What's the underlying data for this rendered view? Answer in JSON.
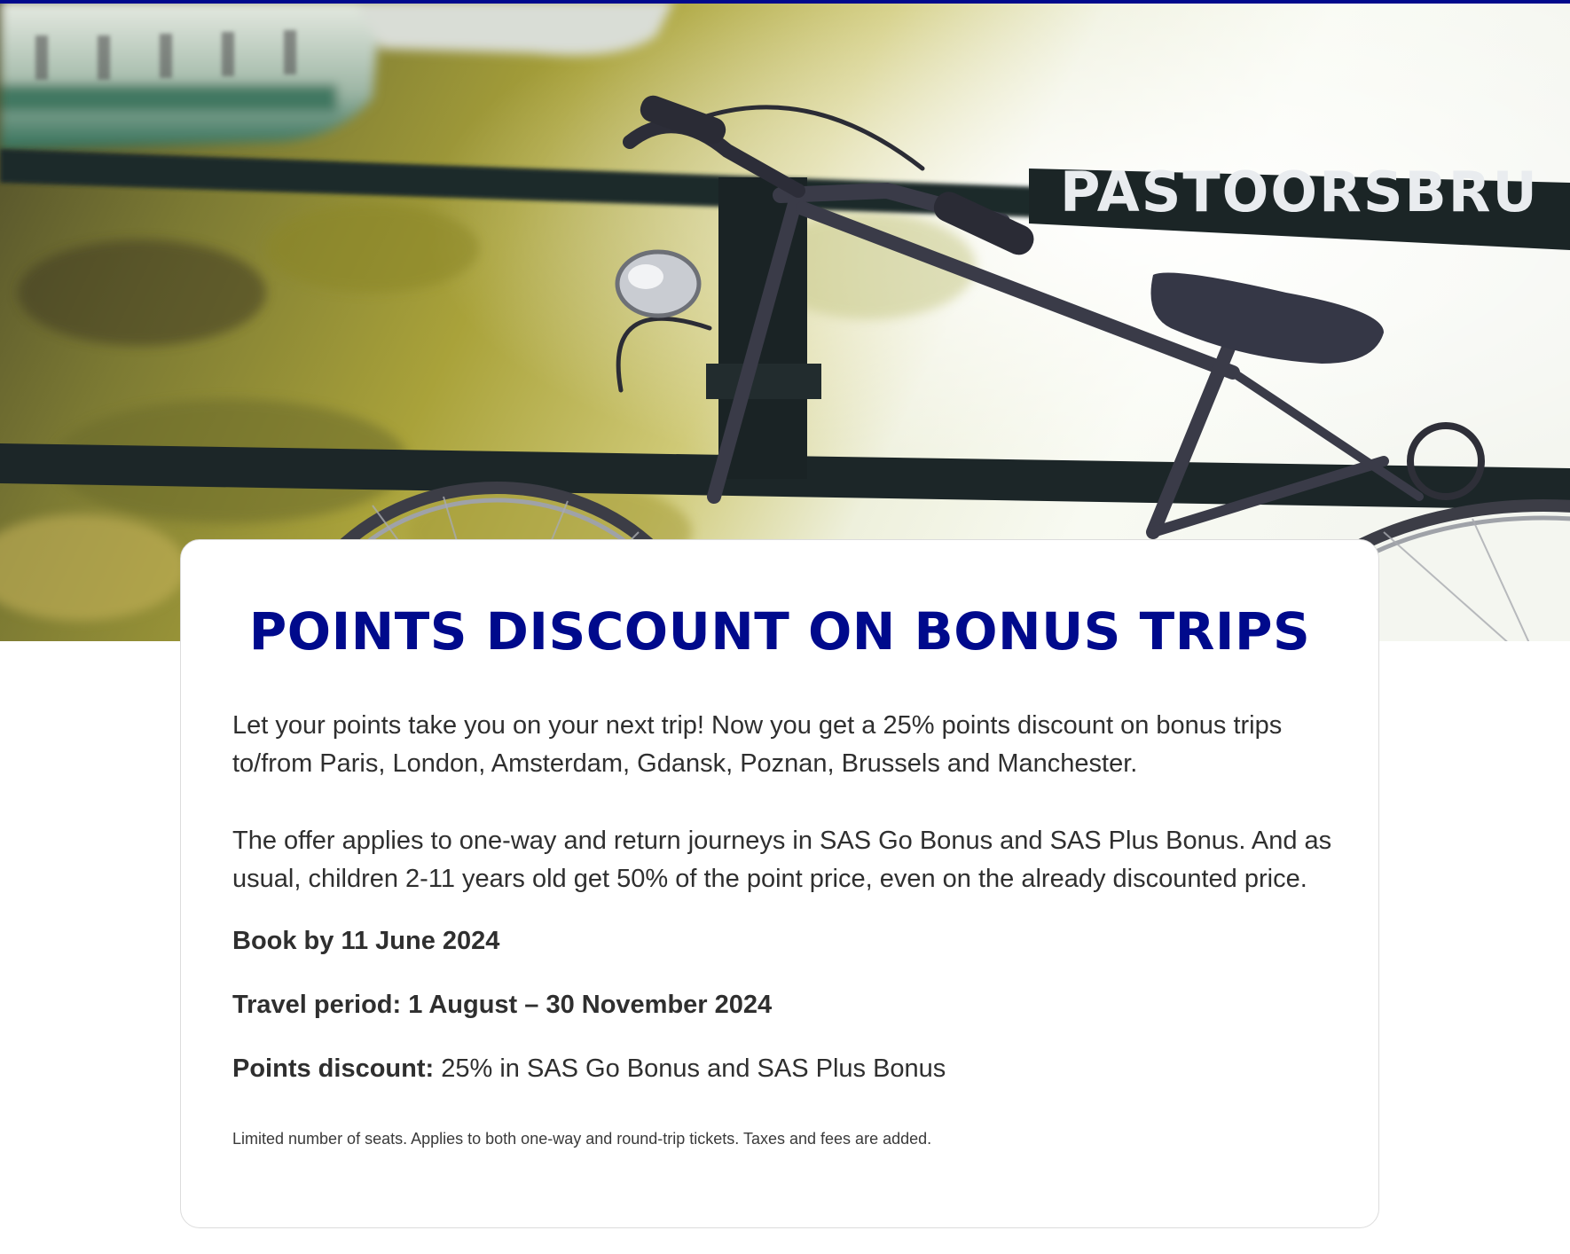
{
  "hero": {
    "sign_text": "PASTOORSBRU"
  },
  "card": {
    "title": "POINTS DISCOUNT ON BONUS TRIPS",
    "intro": "Let your points take you on your next trip! Now you get a 25% points discount on bonus trips to/from Paris, London, Amsterdam, Gdansk, Poznan, Brussels and Manchester.",
    "offer_details": "The offer applies to one-way and return journeys in SAS Go Bonus and SAS Plus Bonus. And as usual, children 2-11 years old get 50% of the point price, even on the already discounted price.",
    "book_by": "Book by 11 June 2024",
    "travel_period": "Travel period: 1 August – 30 November 2024",
    "points_discount_label": "Points discount:",
    "points_discount_value": " 25% in SAS Go Bonus and SAS Plus Bonus",
    "fine_print": "Limited number of seats. Applies to both one-way and round-trip tickets. Taxes and fees are added."
  },
  "colors": {
    "brand_blue": "#000a8c",
    "body_text": "#2f2f2f"
  }
}
